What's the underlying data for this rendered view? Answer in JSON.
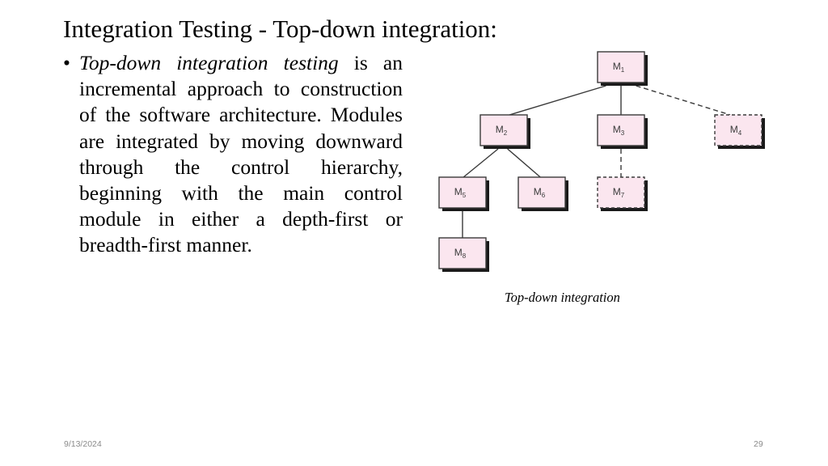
{
  "slide": {
    "title": "Integration Testing - Top-down integration:",
    "bullet": {
      "marker": "•",
      "italic_lead": "Top-down integration testing",
      "rest": " is an incremental approach to construction of the software architecture. Modules are integrated by moving downward through the control hierarchy, beginning with the main control module in either a depth-first or breadth-first manner."
    },
    "footer": {
      "date": "9/13/2024",
      "page_number": "29"
    }
  },
  "diagram": {
    "caption": "Top-down integration",
    "colors": {
      "node_fill": "#fbe6ef",
      "node_border": "#3a3a3a",
      "shadow": "#1a1a1a",
      "edge": "#3a3a3a"
    },
    "nodes": [
      {
        "id": "M1",
        "base": "M",
        "sub": "1",
        "style": "solid"
      },
      {
        "id": "M2",
        "base": "M",
        "sub": "2",
        "style": "solid"
      },
      {
        "id": "M3",
        "base": "M",
        "sub": "3",
        "style": "solid"
      },
      {
        "id": "M4",
        "base": "M",
        "sub": "4",
        "style": "dashed"
      },
      {
        "id": "M5",
        "base": "M",
        "sub": "5",
        "style": "solid"
      },
      {
        "id": "M6",
        "base": "M",
        "sub": "6",
        "style": "solid"
      },
      {
        "id": "M7",
        "base": "M",
        "sub": "7",
        "style": "dashed"
      },
      {
        "id": "M8",
        "base": "M",
        "sub": "8",
        "style": "solid"
      }
    ],
    "edges": [
      {
        "from": "M1",
        "to": "M2",
        "style": "solid"
      },
      {
        "from": "M1",
        "to": "M3",
        "style": "solid"
      },
      {
        "from": "M1",
        "to": "M4",
        "style": "dashed"
      },
      {
        "from": "M2",
        "to": "M5",
        "style": "solid"
      },
      {
        "from": "M2",
        "to": "M6",
        "style": "solid"
      },
      {
        "from": "M3",
        "to": "M7",
        "style": "dashed"
      },
      {
        "from": "M5",
        "to": "M8",
        "style": "solid"
      }
    ]
  }
}
